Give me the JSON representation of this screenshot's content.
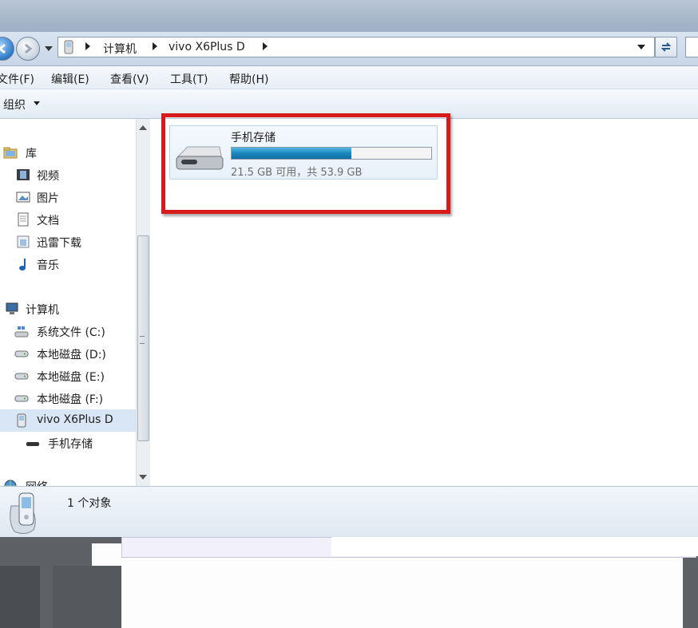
{
  "address": {
    "crumbs": [
      "计算机",
      "vivo X6Plus D"
    ]
  },
  "menu": [
    "文件(F)",
    "编辑(E)",
    "查看(V)",
    "工具(T)",
    "帮助(H)"
  ],
  "toolbar": {
    "organize": "组织"
  },
  "nav": {
    "libraries": "库",
    "library_items": [
      "视频",
      "图片",
      "文档",
      "迅雷下载",
      "音乐"
    ],
    "computer": "计算机",
    "computer_items": [
      "系统文件 (C:)",
      "本地磁盘 (D:)",
      "本地磁盘 (E:)",
      "本地磁盘 (F:)",
      "vivo X6Plus D"
    ],
    "device_child": "手机存储",
    "network": "网络"
  },
  "drive": {
    "name": "手机存储",
    "capacity_text": "21.5 GB 可用，共 53.9 GB",
    "used_fraction": 0.6
  },
  "status": {
    "text": "1 个对象"
  }
}
